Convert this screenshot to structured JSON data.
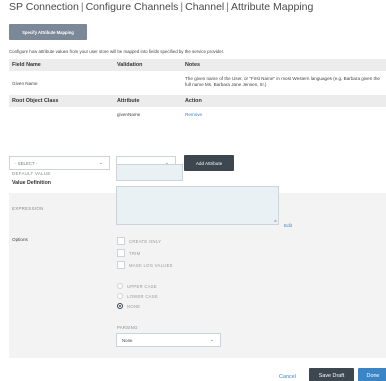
{
  "breadcrumb": [
    "SP Connection",
    "Configure Channels",
    "Channel",
    "Attribute Mapping"
  ],
  "specify_button": "Specify Attribute Mapping",
  "description": "Configure how attribute values from your user store will be mapped into fields specified by the service provider.",
  "fields_table": {
    "headers": [
      "Field Name",
      "Validation",
      "Notes"
    ],
    "row": {
      "field_name": "Given Name",
      "validation": "",
      "notes": "The given name of the User, or \"First Name\" in most Western languages (e.g. Barbara given the full name Ms. Barbara Jane Jensen, III.)"
    }
  },
  "root_table": {
    "headers": [
      "Root Object Class",
      "Attribute",
      "Action"
    ],
    "row": {
      "root": "",
      "attribute": "givenName",
      "action": "Remove"
    }
  },
  "root_select": {
    "value": "- SELECT -"
  },
  "attribute_select": {
    "value": ""
  },
  "add_attribute_button": "Add Attribute",
  "value_definition": {
    "title": "Value Definition",
    "default_label": "DEFAULT VALUE",
    "default_value": "",
    "expression_label": "EXPRESSION",
    "expression_value": "",
    "edit_link": "Edit"
  },
  "options": {
    "label": "Options",
    "checkboxes": [
      {
        "label": "CREATE ONLY",
        "checked": false
      },
      {
        "label": "TRIM",
        "checked": false
      },
      {
        "label": "MASK LOG VALUES",
        "checked": false
      }
    ],
    "case_radios": [
      {
        "label": "UPPER CASE",
        "selected": false
      },
      {
        "label": "LOWER CASE",
        "selected": false
      },
      {
        "label": "NONE",
        "selected": true
      }
    ],
    "parsing_label": "PARSING",
    "parsing_value": "None"
  },
  "footer": {
    "cancel": "Cancel",
    "save_draft": "Save Draft",
    "done": "Done"
  },
  "colors": {
    "accent": "#3a85c6",
    "dark_button": "#3d4750",
    "specify_button": "#7a8898"
  }
}
